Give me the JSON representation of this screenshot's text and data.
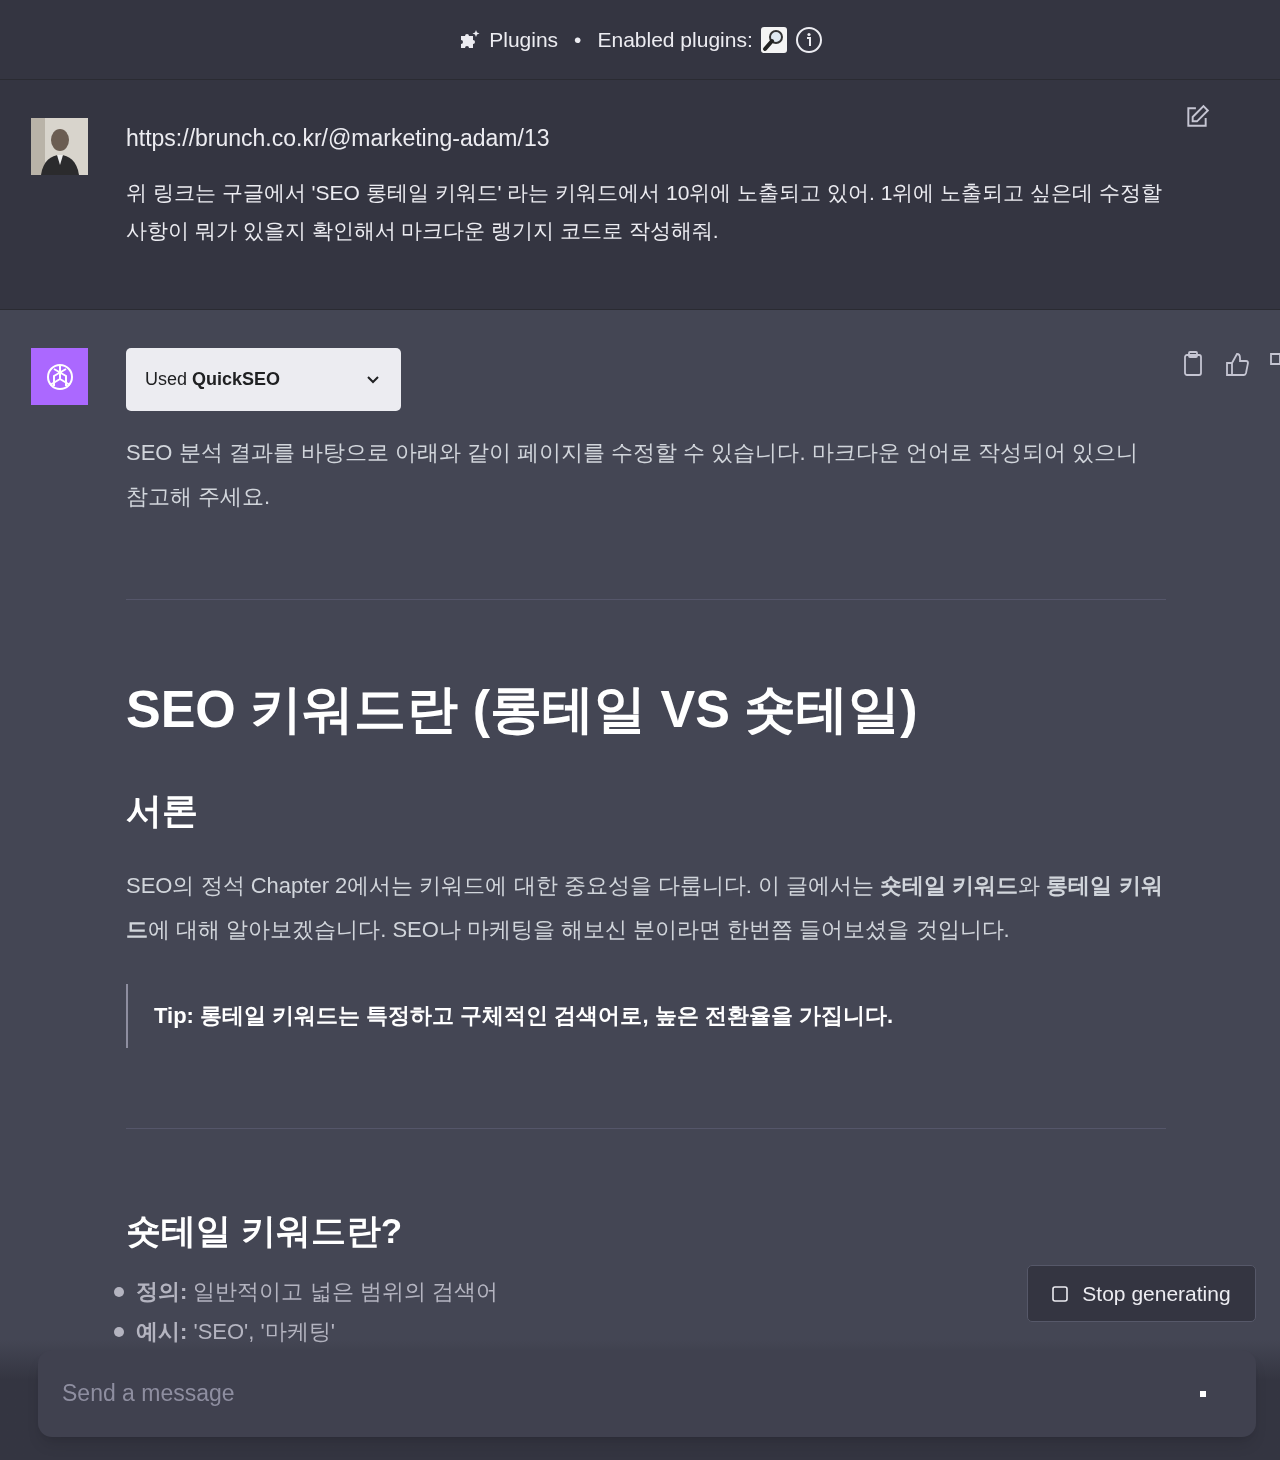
{
  "header": {
    "title": "Plugins",
    "separator": "•",
    "enabled_label": "Enabled plugins:"
  },
  "user_message": {
    "link": "https://brunch.co.kr/@marketing-adam/13",
    "text": "위 링크는 구글에서 'SEO 롱테일 키워드' 라는 키워드에서 10위에 노출되고 있어. 1위에 노출되고 싶은데 수정할 사항이 뭐가 있을지 확인해서 마크다운 랭기지 코드로 작성해줘."
  },
  "assistant_message": {
    "plugin_used": "Used **QuickSEO**",
    "intro": "SEO 분석 결과를 바탕으로 아래와 같이 페이지를 수정할 수 있습니다. 마크다운 언어로 작성되어 있으니 참고해 주세요.",
    "blocks": [
      {
        "kind": "rule"
      },
      {
        "kind": "h1",
        "text": "SEO 키워드란 (롱테일 VS 숏테일)"
      },
      {
        "kind": "h2",
        "text": "서론"
      },
      {
        "kind": "p",
        "text": "SEO의 정석 Chapter 2에서는 키워드에 대한 중요성을 다룹니다. 이 글에서는 **숏테일 키워드**와 **롱테일 키워드**에 대해 알아보겠습니다. SEO나 마케팅을 해보신 분이라면 한번쯤 들어보셨을 것입니다."
      },
      {
        "kind": "quote",
        "text": "**Tip:** 롱테일 키워드는 특정하고 구체적인 검색어로, 높은 전환율을 가집니다."
      },
      {
        "kind": "rule"
      },
      {
        "kind": "h3",
        "text": "숏테일 키워드란?"
      },
      {
        "kind": "list",
        "items": [
          "**정의:** 일반적이고 넓은 범위의 검색어",
          "**예시:** 'SEO', '마케팅'"
        ]
      }
    ]
  },
  "stop_button": {
    "label": "Stop generating"
  },
  "composer": {
    "placeholder": "Send a message"
  }
}
